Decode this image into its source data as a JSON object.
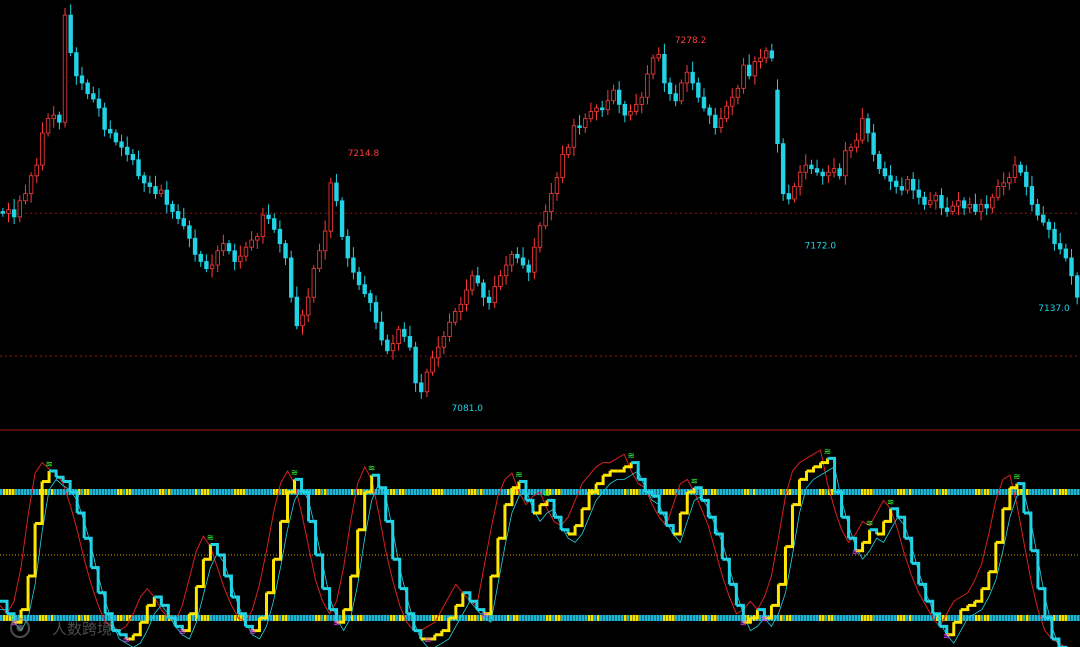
{
  "colors": {
    "background": "#000000",
    "up_candle": "#ff3b3b",
    "down_candle": "#22d3e6",
    "high_label": "#ff3b3b",
    "low_label": "#22d3e6",
    "panel_divider": "#a01818",
    "ref_line": "#8b1a1a",
    "osc_cyan": "#22d3e6",
    "osc_yellow": "#ffe600",
    "osc_red": "#d82020",
    "osc_mid": "#d6a100",
    "band_cyan": "#1fb6d6",
    "band_yellow": "#f2e400",
    "marker_green": "#38ff38",
    "marker_magenta": "#e040ff"
  },
  "watermark": {
    "text": "人数跨境",
    "icon": "brand-logo-icon"
  },
  "chart_data": [
    {
      "type": "candlestick",
      "panel": "price",
      "title": "",
      "xlabel": "",
      "ylabel": "",
      "ylim": [
        7072,
        7300
      ],
      "reference_lines": [
        7185,
        7105
      ],
      "grid": false,
      "annotations": [
        {
          "text": "7214.8",
          "kind": "high",
          "x": 70,
          "y": 7214.8
        },
        {
          "text": "7278.2",
          "kind": "high",
          "x": 133,
          "y": 7278.2
        },
        {
          "text": "7081.0",
          "kind": "low",
          "x": 90,
          "y": 7081.0
        },
        {
          "text": "7172.0",
          "kind": "low",
          "x": 158,
          "y": 7172.0
        },
        {
          "text": "7137.0",
          "kind": "low",
          "x": 203,
          "y": 7137.0
        }
      ],
      "close": [
        7185,
        7187,
        7183,
        7192,
        7196,
        7206,
        7212,
        7230,
        7238,
        7240,
        7236,
        7296,
        7275,
        7262,
        7258,
        7252,
        7249,
        7244,
        7232,
        7230,
        7225,
        7222,
        7218,
        7215,
        7206,
        7202,
        7200,
        7196,
        7198,
        7190,
        7186,
        7182,
        7178,
        7171,
        7162,
        7158,
        7154,
        7156,
        7164,
        7168,
        7164,
        7158,
        7161,
        7166,
        7170,
        7172,
        7184,
        7182,
        7176,
        7168,
        7160,
        7138,
        7122,
        7128,
        7138,
        7154,
        7164,
        7175,
        7202,
        7192,
        7172,
        7160,
        7152,
        7145,
        7140,
        7135,
        7124,
        7114,
        7108,
        7112,
        7120,
        7116,
        7110,
        7090,
        7085,
        7096,
        7104,
        7110,
        7116,
        7124,
        7130,
        7134,
        7142,
        7150,
        7146,
        7138,
        7135,
        7144,
        7150,
        7156,
        7162,
        7160,
        7156,
        7152,
        7166,
        7178,
        7186,
        7196,
        7205,
        7218,
        7222,
        7234,
        7233,
        7238,
        7242,
        7244,
        7243,
        7248,
        7254,
        7246,
        7240,
        7242,
        7246,
        7250,
        7263,
        7272,
        7274,
        7258,
        7252,
        7248,
        7258,
        7264,
        7258,
        7250,
        7244,
        7240,
        7233,
        7238,
        7245,
        7250,
        7255,
        7268,
        7262,
        7270,
        7272,
        7276,
        7272,
        7224,
        7196,
        7193,
        7200,
        7208,
        7212,
        7210,
        7208,
        7206,
        7208,
        7210,
        7206,
        7220,
        7222,
        7226,
        7238,
        7230,
        7218,
        7210,
        7206,
        7203,
        7200,
        7198,
        7204,
        7198,
        7194,
        7190,
        7192,
        7195,
        7188,
        7186,
        7189,
        7192,
        7188,
        7190,
        7186,
        7190,
        7188,
        7194,
        7200,
        7202,
        7205,
        7212,
        7208,
        7200,
        7190,
        7184,
        7180,
        7176,
        7168,
        7165,
        7160,
        7150,
        7138
      ]
    },
    {
      "type": "line",
      "panel": "oscillator",
      "title": "",
      "xlabel": "",
      "ylabel": "",
      "ylim": [
        0,
        100
      ],
      "reference_lines": [
        80,
        50,
        20
      ],
      "grid": false,
      "marker_symbols": [
        "buy-marker-icon",
        "sell-marker-icon"
      ],
      "series_values": [
        28,
        22,
        18,
        24,
        40,
        65,
        85,
        90,
        87,
        85,
        80,
        70,
        58,
        44,
        32,
        22,
        14,
        12,
        10,
        12,
        18,
        26,
        30,
        26,
        20,
        16,
        14,
        22,
        35,
        48,
        55,
        50,
        40,
        30,
        22,
        16,
        14,
        20,
        32,
        48,
        66,
        80,
        86,
        80,
        66,
        50,
        34,
        24,
        18,
        24,
        40,
        62,
        80,
        88,
        82,
        66,
        48,
        34,
        22,
        14,
        10,
        10,
        12,
        14,
        20,
        26,
        32,
        28,
        24,
        22,
        40,
        58,
        74,
        82,
        85,
        76,
        70,
        74,
        76,
        68,
        62,
        60,
        64,
        72,
        80,
        84,
        88,
        90,
        90,
        92,
        94,
        86,
        80,
        78,
        70,
        64,
        60,
        70,
        80,
        82,
        76,
        68,
        60,
        48,
        36,
        26,
        18,
        20,
        24,
        20,
        26,
        36,
        54,
        74,
        86,
        90,
        92,
        94,
        96,
        80,
        68,
        58,
        52,
        56,
        62,
        60,
        66,
        72,
        68,
        58,
        46,
        36,
        28,
        22,
        16,
        12,
        18,
        24,
        26,
        28,
        34,
        42,
        56,
        72,
        82,
        84,
        70,
        52,
        34,
        20,
        10,
        6,
        4,
        2
      ]
    }
  ]
}
